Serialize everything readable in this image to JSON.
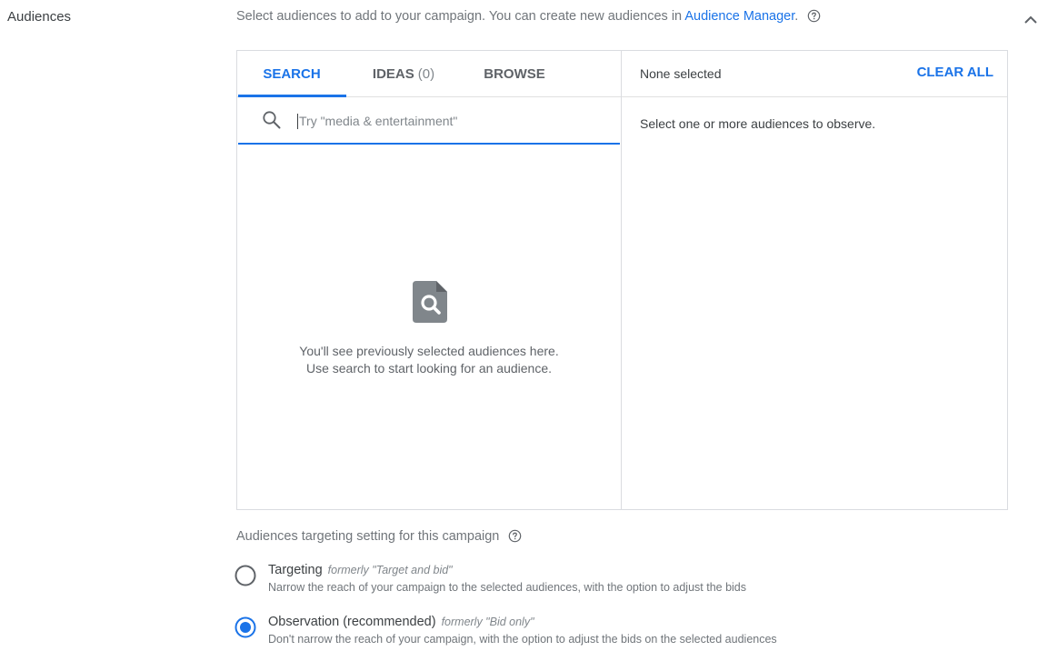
{
  "section": {
    "label": "Audiences",
    "intro_text": "Select audiences to add to your campaign. You can create new audiences in ",
    "intro_link": "Audience Manager",
    "intro_suffix": "."
  },
  "picker": {
    "tabs": [
      {
        "label": "SEARCH",
        "active": true
      },
      {
        "label": "IDEAS",
        "count": "(0)"
      },
      {
        "label": "BROWSE"
      }
    ],
    "search": {
      "placeholder": "Try \"media & entertainment\"",
      "value": ""
    },
    "empty_state": {
      "line1": "You'll see previously selected audiences here.",
      "line2": "Use search to start looking for an audience."
    },
    "selection": {
      "status": "None selected",
      "clear_all_label": "CLEAR ALL",
      "hint": "Select one or more audiences to observe."
    }
  },
  "targeting": {
    "label": "Audiences targeting setting for this campaign",
    "options": [
      {
        "title": "Targeting",
        "formerly": "formerly \"Target and bid\"",
        "description": "Narrow the reach of your campaign to the selected audiences, with the option to adjust the bids",
        "selected": false
      },
      {
        "title": "Observation (recommended)",
        "formerly": "formerly \"Bid only\"",
        "description": "Don't narrow the reach of your campaign, with the option to adjust the bids on the selected audiences",
        "selected": true
      }
    ]
  },
  "icons": {
    "help": "help-circle-icon",
    "search": "magnifier-icon",
    "empty": "document-search-icon",
    "collapse": "chevron-up-icon"
  },
  "colors": {
    "accent": "#1a73e8",
    "text": "#3c4043",
    "muted": "#70757a",
    "border": "#dadce0",
    "icon_gray": "#80868b"
  }
}
